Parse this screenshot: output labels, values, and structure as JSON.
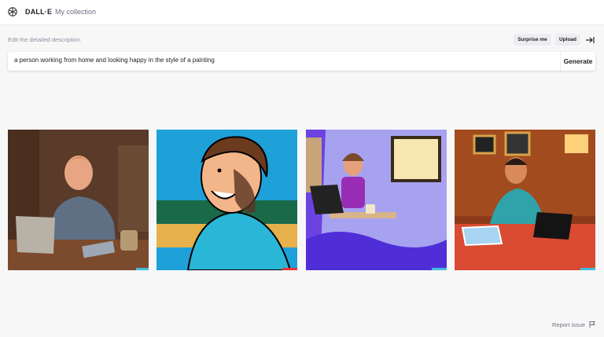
{
  "header": {
    "brand": "DALL·E",
    "nav_collection": "My collection",
    "logo_icon": "openai-logo-icon"
  },
  "editor": {
    "description_label": "Edit the detailed description",
    "surprise_label": "Surprise me",
    "upload_label": "Upload",
    "collapse_icon": "collapse-panel-icon",
    "prompt_value": "a person working from home and looking happy in the style of a painting",
    "generate_label": "Generate"
  },
  "results": [
    {
      "description": "painted man at laptop in brown room"
    },
    {
      "description": "comic style laughing man in blue hoodie"
    },
    {
      "description": "flat art person at laptop in purple room"
    },
    {
      "description": "painted man at laptop on red table"
    }
  ],
  "footer": {
    "report_label": "Report issue",
    "report_icon": "flag-icon"
  },
  "colors": {
    "background": "#f7f7f8",
    "accent_dark": "#202123"
  }
}
